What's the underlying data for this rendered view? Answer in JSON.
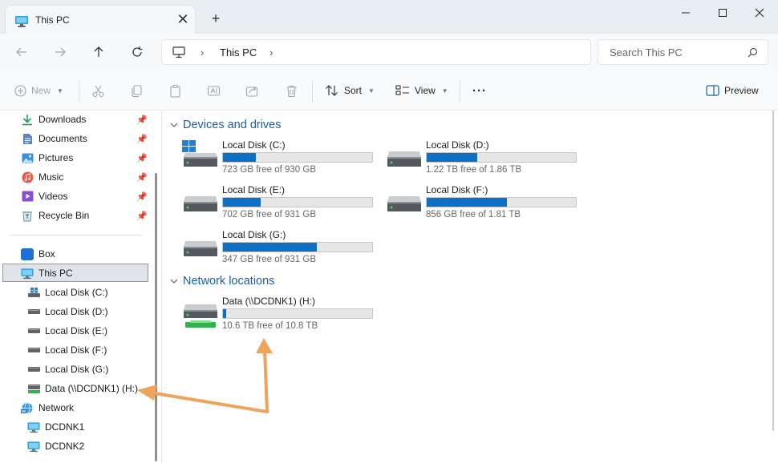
{
  "window": {
    "tab_title": "This PC",
    "new_tab_symbol": "+",
    "close_symbol": "✕"
  },
  "address": {
    "path_item": "This PC",
    "search_placeholder": "Search This PC"
  },
  "toolbar": {
    "new_label": "New",
    "sort_label": "Sort",
    "view_label": "View",
    "more_label": "···",
    "preview_label": "Preview"
  },
  "sidebar": {
    "quick_access": [
      {
        "label": "Downloads",
        "icon": "download-icon"
      },
      {
        "label": "Documents",
        "icon": "documents-icon"
      },
      {
        "label": "Pictures",
        "icon": "pictures-icon"
      },
      {
        "label": "Music",
        "icon": "music-icon"
      },
      {
        "label": "Videos",
        "icon": "videos-icon"
      },
      {
        "label": "Recycle Bin",
        "icon": "recycle-bin-icon"
      }
    ],
    "box": {
      "label": "Box",
      "badge": "box"
    },
    "this_pc": {
      "label": "This PC"
    },
    "drives": [
      {
        "label": "Local Disk (C:)"
      },
      {
        "label": "Local Disk (D:)"
      },
      {
        "label": "Local Disk (E:)"
      },
      {
        "label": "Local Disk (F:)"
      },
      {
        "label": "Local Disk (G:)"
      },
      {
        "label": "Data (\\\\DCDNK1) (H:)"
      }
    ],
    "network": {
      "label": "Network"
    },
    "computers": [
      {
        "label": "DCDNK1"
      },
      {
        "label": "DCDNK2"
      }
    ]
  },
  "content": {
    "devices_header": "Devices and drives",
    "network_header": "Network locations",
    "drives": [
      {
        "name": "Local Disk (C:)",
        "free": "723 GB free of 930 GB",
        "used_fraction": 0.22,
        "system": true
      },
      {
        "name": "Local Disk (D:)",
        "free": "1.22 TB free of 1.86 TB",
        "used_fraction": 0.34
      },
      {
        "name": "Local Disk (E:)",
        "free": "702 GB free of 931 GB",
        "used_fraction": 0.25
      },
      {
        "name": "Local Disk (F:)",
        "free": "856 GB free of 1.81 TB",
        "used_fraction": 0.54
      },
      {
        "name": "Local Disk (G:)",
        "free": "347 GB free of 931 GB",
        "used_fraction": 0.63
      }
    ],
    "network_drives": [
      {
        "name": "Data (\\\\DCDNK1) (H:)",
        "free": "10.6 TB free of 10.8 TB",
        "used_fraction": 0.02
      }
    ]
  },
  "colors": {
    "accent": "#0f6fc6",
    "header_blue": "#1a5fa8",
    "annotation_arrow": "#f0a35a"
  }
}
